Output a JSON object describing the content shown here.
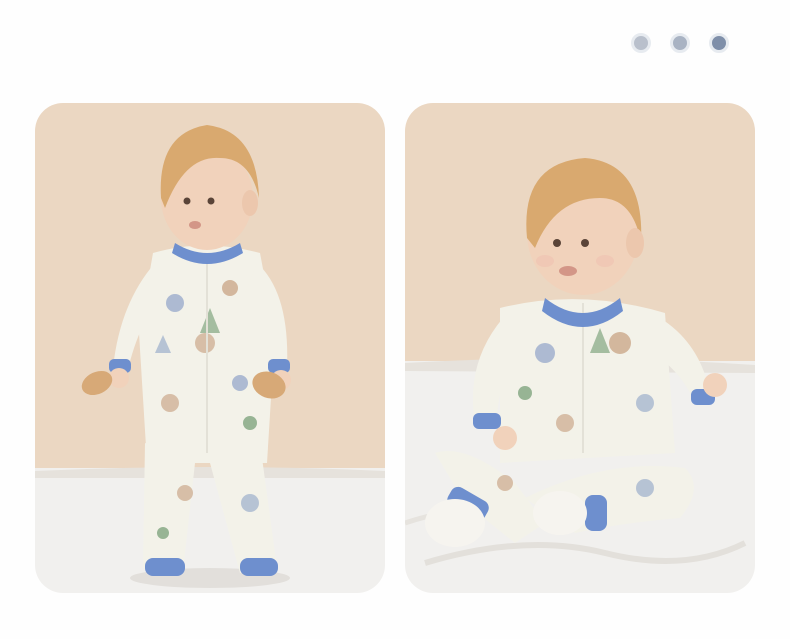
{
  "colors": {
    "wall": "#ebd7c2",
    "bedding": "#f1f0ee",
    "hair": "#d9a96f",
    "skin": "#f1d2bb",
    "romper": "#f3f2e9",
    "trim": "#6e8fce",
    "print_blue": "#8ea3c7",
    "print_tan": "#caa88a",
    "print_green": "#6f9a6f",
    "toy_wood": "#d7a977",
    "dots": [
      "#b9c0cc",
      "#a9b3c3",
      "#7f8fa9"
    ]
  },
  "gallery": {
    "photos": [
      {
        "subject": "standing-toddler-photo"
      },
      {
        "subject": "sitting-toddler-photo"
      }
    ],
    "dot_count": 3,
    "active_dot": 2
  }
}
